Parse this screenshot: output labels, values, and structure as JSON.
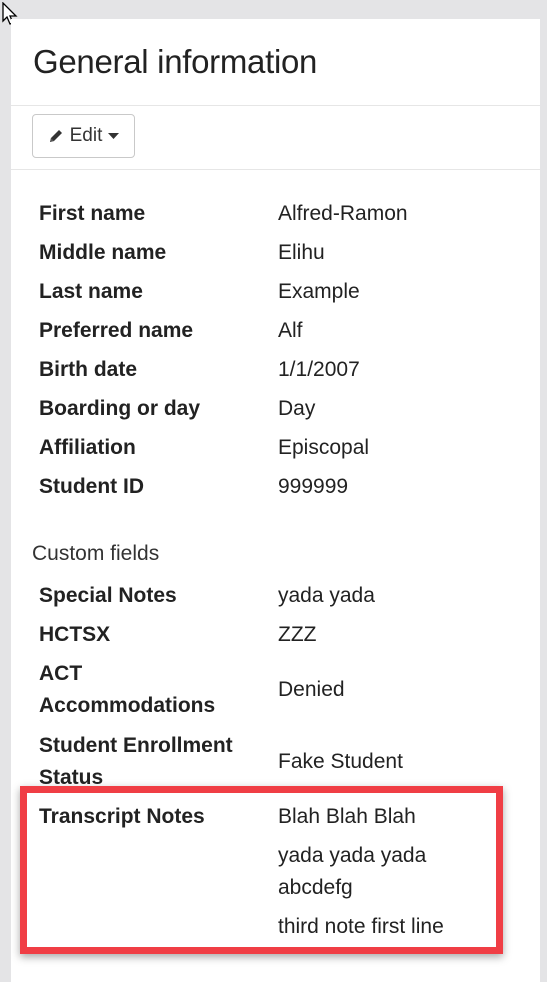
{
  "panel": {
    "title": "General information",
    "edit_label": "Edit"
  },
  "fields": [
    {
      "label": "First name",
      "value": "Alfred-Ramon"
    },
    {
      "label": "Middle name",
      "value": "Elihu"
    },
    {
      "label": "Last name",
      "value": "Example"
    },
    {
      "label": "Preferred name",
      "value": "Alf"
    },
    {
      "label": "Birth date",
      "value": "1/1/2007"
    },
    {
      "label": "Boarding or day",
      "value": "Day"
    },
    {
      "label": "Affiliation",
      "value": "Episcopal"
    },
    {
      "label": "Student ID",
      "value": "999999"
    }
  ],
  "custom": {
    "heading": "Custom fields",
    "fields": [
      {
        "label": "Special Notes",
        "value": "yada yada"
      },
      {
        "label": "HCTSX",
        "value": "ZZZ"
      },
      {
        "label": "ACT Accommodations",
        "label_line1": "ACT",
        "label_line2": "Accommodations",
        "value": "Denied"
      },
      {
        "label": "Student Enrollment Status",
        "label_line1": "Student Enrollment",
        "label_line2": "Status",
        "value": "Fake Student"
      },
      {
        "label": "Transcript Notes",
        "values": [
          "Blah Blah Blah",
          "yada yada yada abcdefg",
          "third note first line"
        ]
      }
    ]
  },
  "colors": {
    "highlight": "#f03e45"
  },
  "icons": {
    "cursor": "mouse-pointer-icon",
    "edit": "pencil-icon",
    "dropdown": "caret-down-icon"
  }
}
